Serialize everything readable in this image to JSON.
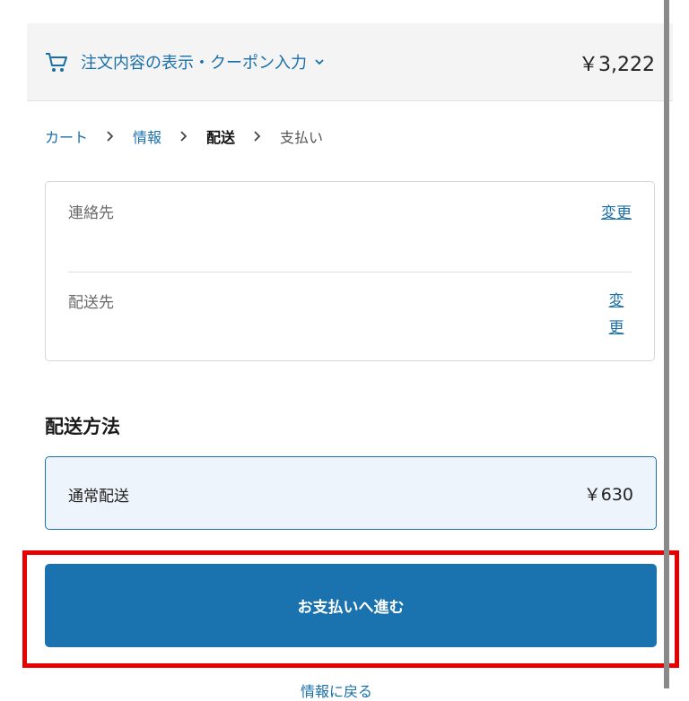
{
  "summary": {
    "toggle_label": "注文内容の表示・クーポン入力",
    "total": "￥3,222"
  },
  "breadcrumb": {
    "cart": "カート",
    "info": "情報",
    "shipping": "配送",
    "payment": "支払い"
  },
  "review": {
    "contact_label": "連絡先",
    "contact_change": "変更",
    "ship_to_label": "配送先",
    "ship_to_change": "変更"
  },
  "shipping_method": {
    "title": "配送方法",
    "option_label": "通常配送",
    "option_price": "￥630"
  },
  "actions": {
    "continue_label": "お支払いへ進む",
    "back_label": "情報に戻る"
  },
  "colors": {
    "accent": "#1a72ae",
    "link": "#1a6fa8",
    "highlight": "#e60000",
    "selected_bg": "#eef4fc"
  },
  "icons": {
    "cart": "cart-icon",
    "toggle": "chevron-down-icon",
    "separator": "chevron-right-icon"
  }
}
